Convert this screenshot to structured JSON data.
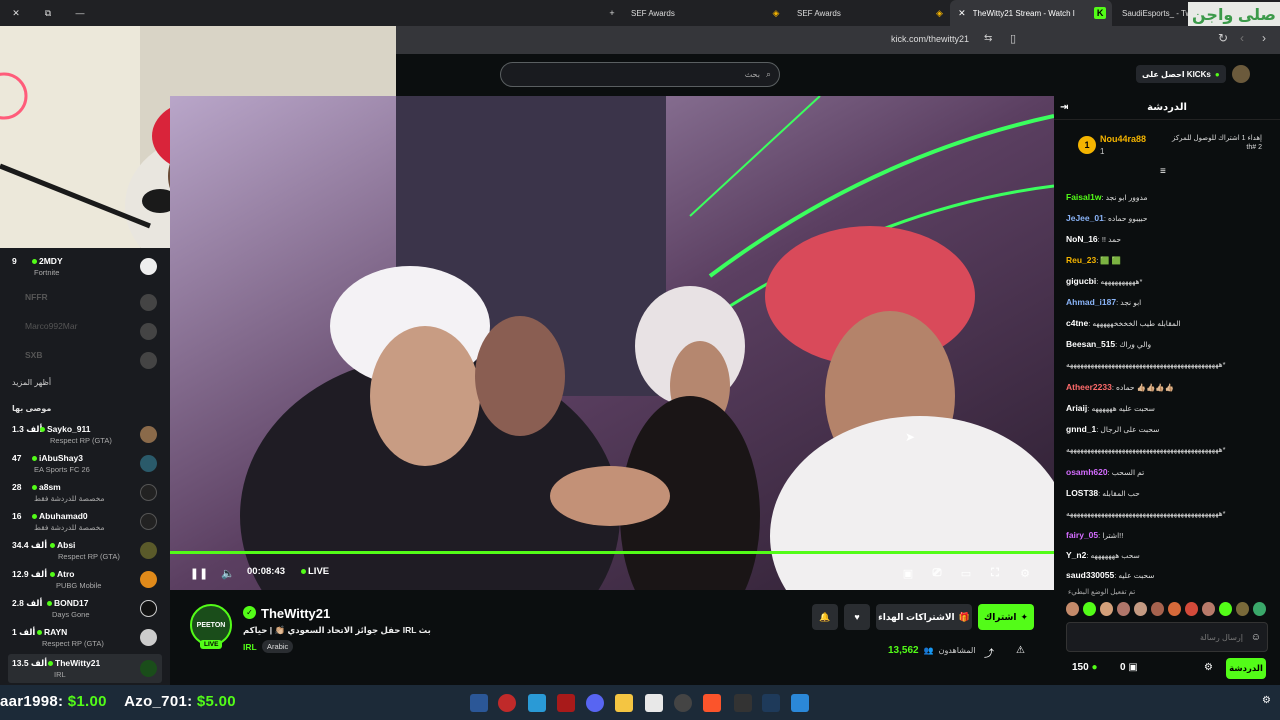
{
  "browser": {
    "tabs": [
      {
        "label": "SEF Awards"
      },
      {
        "label": "SEF Awards"
      },
      {
        "label": "TheWitty21 Stream - Watch l"
      },
      {
        "label": "SaudiEsports_ - Twitch"
      }
    ],
    "url": "kick.com/thewitty21",
    "overlay_text": "صلى واجن"
  },
  "header": {
    "search_placeholder": "بحث",
    "get_kicks_label": "احصل على KICKs"
  },
  "sidebar": {
    "channels_top": [
      {
        "count": "9",
        "name": "2MDY",
        "category": "Fortnite",
        "online": true
      },
      {
        "count": "",
        "name": "NFFR",
        "category": "",
        "online": false
      },
      {
        "count": "",
        "name": "Marco992Mar",
        "category": "",
        "online": false
      },
      {
        "count": "",
        "name": "SXB",
        "category": "",
        "online": false
      }
    ],
    "show_more": "أظهر المزيد",
    "recommended_title": "موصى بها",
    "recommended": [
      {
        "count": "1.3 ألف",
        "name": "Sayko_911",
        "category": "Respect RP (GTA)"
      },
      {
        "count": "47",
        "name": "iAbuShay3",
        "category": "EA Sports FC 26"
      },
      {
        "count": "28",
        "name": "a8sm",
        "category": "مخصصة للدردشة فقط"
      },
      {
        "count": "16",
        "name": "Abuhamad0",
        "category": "مخصصة للدردشة فقط"
      },
      {
        "count": "34.4 ألف",
        "name": "Absi",
        "category": "Respect RP (GTA)"
      },
      {
        "count": "12.9 ألف",
        "name": "Atro",
        "category": "PUBG Mobile"
      },
      {
        "count": "2.8 ألف",
        "name": "BOND17",
        "category": "Days Gone"
      },
      {
        "count": "1 ألف",
        "name": "RAYN",
        "category": "Respect RP (GTA)"
      },
      {
        "count": "13.5 ألف",
        "name": "TheWitty21",
        "category": "IRL"
      }
    ]
  },
  "player": {
    "time": "00:08:43",
    "live_label": "LIVE",
    "progress": 1.0
  },
  "channel": {
    "name": "TheWitty21",
    "logo_text": "PEETON",
    "live_badge": "LIVE",
    "title": "حفل جوائز الاتحاد السعودي 👏🏼 | حياكم IRL بث",
    "category": "IRL",
    "language": "Arabic",
    "subscribe_label": "اشتراك",
    "gift_label": "الاشتراكات الهداء",
    "viewers_label": "المشاهدون",
    "viewers_count": "13,562"
  },
  "chat": {
    "title": "الدردشة",
    "pinned": {
      "rank": "1",
      "user": "Nou44ra88",
      "sub": "1",
      "text": "إهداء 1 اشتراك للوصول للمركز 2 #th"
    },
    "messages": [
      {
        "user": "Faisal1w",
        "color": "#53fc18",
        "text": "مدوور ابو نجد"
      },
      {
        "user": "JeJee_01",
        "color": "#8ab4f8",
        "text": "حبيبوو حماده"
      },
      {
        "user": "NoN_16",
        "color": "#ffffff",
        "text": "!! حمد"
      },
      {
        "user": "Reu_23",
        "color": "#f4b400",
        "text": "🟩 🟩"
      },
      {
        "user": "gigucbi",
        "color": "#ffffff",
        "text": "ههههههههههه*"
      },
      {
        "user": "Ahmad_i187",
        "color": "#8ab4f8",
        "text": "ابو نجد"
      },
      {
        "user": "c4tne",
        "color": "#ffffff",
        "text": "المقابله طيب الخخخخهههههه"
      },
      {
        "user": "Beesan_515",
        "color": "#ffffff",
        "text": "والي وراك"
      },
      {
        "user": "",
        "color": "#ffffff",
        "text": "ههههههههههههههههههههههههههههههههههههههههههههه*"
      },
      {
        "user": "Atheer2233",
        "color": "#ff6b6b",
        "text": "حماده 👍🏼👍🏼👍🏼👍🏼"
      },
      {
        "user": "Ariaij",
        "color": "#ffffff",
        "text": "سحبت عليه ههههههه"
      },
      {
        "user": "gnnd_1",
        "color": "#ffffff",
        "text": "سحبت على الرجال"
      },
      {
        "user": "",
        "color": "#ffffff",
        "text": "ههههههههههههههههههههههههههههههههههههههههههههه*"
      },
      {
        "user": "osamh620",
        "color": "#d46cff",
        "text": "تم السحب"
      },
      {
        "user": "LOST38",
        "color": "#ffffff",
        "text": "حب المقابله"
      },
      {
        "user": "",
        "color": "#ffffff",
        "text": "ههههههههههههههههههههههههههههههههههههههههههههه*"
      },
      {
        "user": "fairy_05",
        "color": "#d46cff",
        "text": "اشترا!!"
      },
      {
        "user": "Y_n2",
        "color": "#ffffff",
        "text": "سحب هههههههه"
      },
      {
        "user": "saud330055",
        "color": "#ffffff",
        "text": "سحبت عليه"
      }
    ],
    "slow_mode": "تم تفعيل الوضع البطيء",
    "input_placeholder": "إرسال رسالة",
    "kicks_count": "150",
    "zero_count": "0",
    "chat_button": "الدردشة"
  },
  "taskbar": {
    "donation_1_user": "aar1998:",
    "donation_1_amount": "$1.00",
    "donation_2_user": "Azo_701:",
    "donation_2_amount": "$5.00"
  },
  "colors": {
    "accent": "#53fc18",
    "bg": "#0b0e0f",
    "panel": "#191b1f"
  }
}
